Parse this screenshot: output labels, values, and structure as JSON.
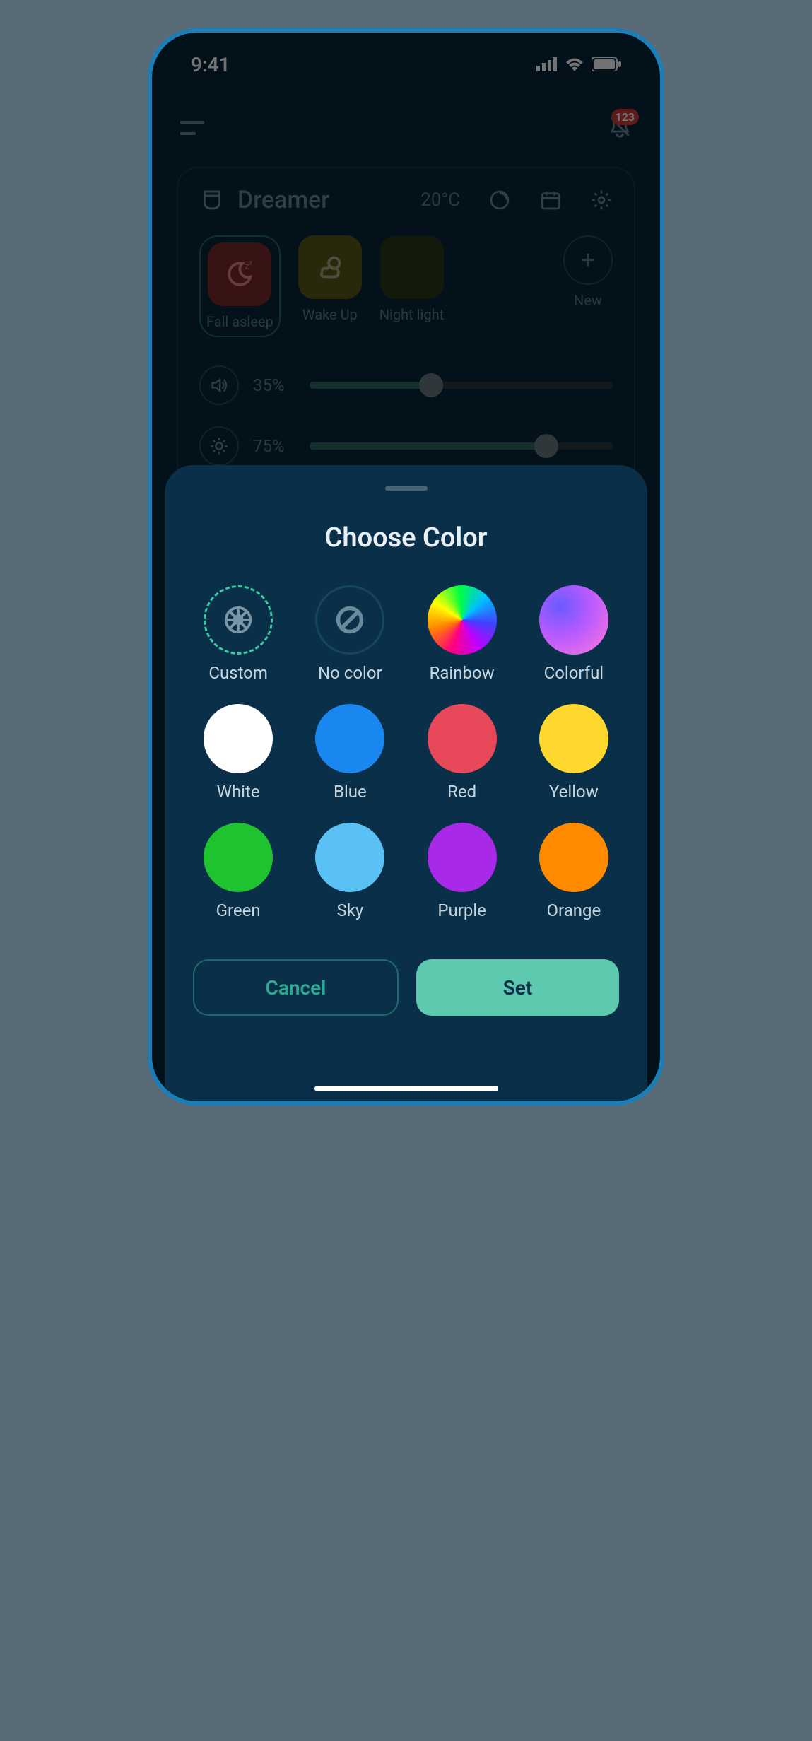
{
  "status": {
    "time": "9:41"
  },
  "notifications": {
    "badge": "123"
  },
  "device": {
    "name": "Dreamer",
    "temperature": "20°C",
    "scenes": [
      {
        "label": "Fall asleep"
      },
      {
        "label": "Wake Up"
      },
      {
        "label": "Night light"
      }
    ],
    "new_label": "New",
    "volume": {
      "percent_label": "35%",
      "percent": 35
    },
    "brightness": {
      "percent_label": "75%",
      "percent": 75
    }
  },
  "sheet": {
    "title": "Choose Color",
    "colors": [
      {
        "label": "Custom"
      },
      {
        "label": "No color"
      },
      {
        "label": "Rainbow"
      },
      {
        "label": "Colorful"
      },
      {
        "label": "White"
      },
      {
        "label": "Blue"
      },
      {
        "label": "Red"
      },
      {
        "label": "Yellow"
      },
      {
        "label": "Green"
      },
      {
        "label": "Sky"
      },
      {
        "label": "Purple"
      },
      {
        "label": "Orange"
      }
    ],
    "cancel_label": "Cancel",
    "set_label": "Set"
  }
}
